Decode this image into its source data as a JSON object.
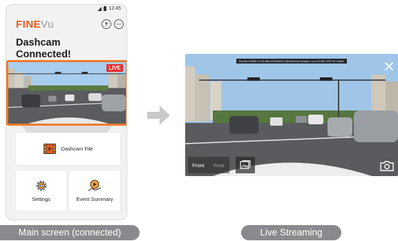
{
  "phone": {
    "status_time": "12:45",
    "logo_fine": "FINE",
    "logo_vu": "Vu",
    "headline_line1": "Dashcam",
    "headline_line2": "Connected!",
    "live_badge": "LIVE",
    "menu": {
      "dashcam_file": "Dashcam File",
      "settings": "Settings",
      "event_summary": "Event Summary"
    }
  },
  "stream": {
    "overlay_text": "FineVu GX300 V1.00.006  2021/02/22 13h32m21s  012mph  1.a:4.1V  MIC OFF  20.3 AMV",
    "tabs": [
      "Front",
      "Rear"
    ],
    "active_tab": "Front"
  },
  "captions": {
    "left": "Main screen (connected)",
    "right": "Live Streaming"
  },
  "colors": {
    "accent": "#e8591c",
    "live_border": "#f07a2b",
    "live_badge": "#e52a2a",
    "caption_bg": "#8a8a8e",
    "arrow": "#c9c9cc"
  },
  "icons": [
    "signal-icon",
    "battery-icon",
    "upload-icon",
    "more-icon",
    "film-icon",
    "settings-gear-icon",
    "event-summary-icon",
    "arrow-right-icon",
    "close-icon",
    "gallery-icon",
    "camera-icon"
  ]
}
